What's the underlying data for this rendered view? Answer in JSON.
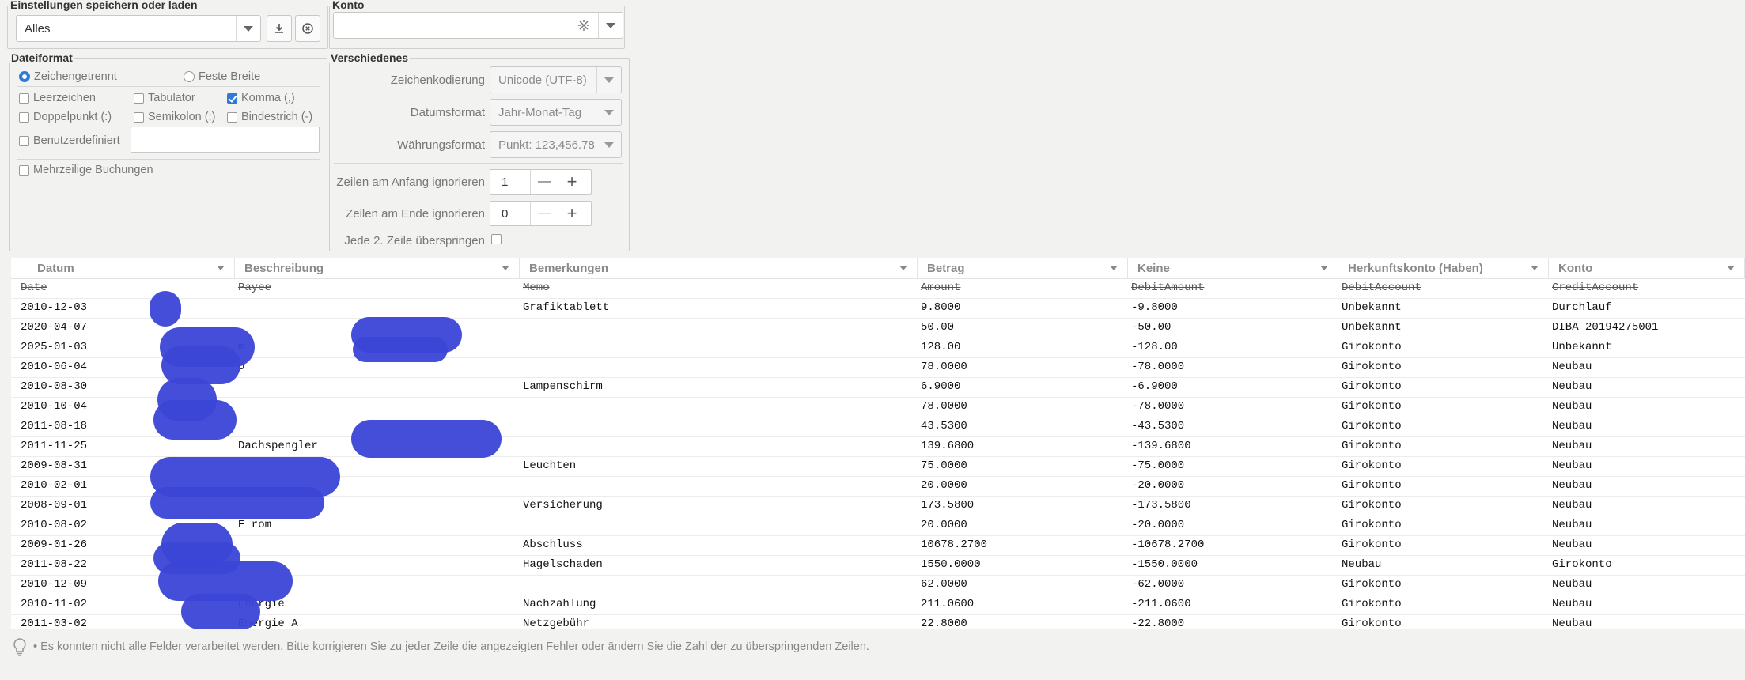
{
  "settings": {
    "legend": "Einstellungen speichern oder laden",
    "preset_value": "Alles",
    "save_icon": "download-icon",
    "clear_icon": "circle-x-icon"
  },
  "konto": {
    "legend": "Konto",
    "value": ""
  },
  "dateiformat": {
    "legend": "Dateiformat",
    "radio_delimited": "Zeichengetrennt",
    "radio_fixed": "Feste Breite",
    "space": "Leerzeichen",
    "tab": "Tabulator",
    "comma": "Komma (,)",
    "colon": "Doppelpunkt (:)",
    "semicolon": "Semikolon (;)",
    "dash": "Bindestrich (-)",
    "custom": "Benutzerdefiniert",
    "multiline": "Mehrzeilige Buchungen"
  },
  "verschiedenes": {
    "legend": "Verschiedenes",
    "encoding_label": "Zeichenkodierung",
    "encoding_value": "Unicode (UTF-8)",
    "date_label": "Datumsformat",
    "date_value": "Jahr-Monat-Tag",
    "currency_label": "Währungsformat",
    "currency_value": "Punkt: 123,456.78",
    "skip_start_label": "Zeilen am Anfang ignorieren",
    "skip_start_value": "1",
    "skip_end_label": "Zeilen am Ende ignorieren",
    "skip_end_value": "0",
    "every_second_label": "Jede 2. Zeile überspringen",
    "minus": "—",
    "plus": "+"
  },
  "table": {
    "columns": [
      "Datum",
      "Beschreibung",
      "Bemerkungen",
      "Betrag",
      "Keine",
      "Herkunftskonto (Haben)",
      "Konto"
    ],
    "header_row": [
      "Date",
      "Payee",
      "Memo",
      "Amount",
      "DebitAmount",
      "DebitAccount",
      "CreditAccount"
    ],
    "rows": [
      [
        "2010-12-03",
        "",
        "Grafiktablett",
        "9.8000",
        "-9.8000",
        "Unbekannt",
        "Durchlauf"
      ],
      [
        "2020-04-07",
        "",
        "",
        "50.00",
        "-50.00",
        "Unbekannt",
        "DIBA 20194275001"
      ],
      [
        "2025-01-03",
        "m",
        "",
        "128.00",
        "-128.00",
        "Girokonto",
        "Unbekannt"
      ],
      [
        "2010-06-04",
        "ö",
        "",
        "78.0000",
        "-78.0000",
        "Girokonto",
        "Neubau"
      ],
      [
        "2010-08-30",
        "",
        "Lampenschirm",
        "6.9000",
        "-6.9000",
        "Girokonto",
        "Neubau"
      ],
      [
        "2010-10-04",
        "",
        "",
        "78.0000",
        "-78.0000",
        "Girokonto",
        "Neubau"
      ],
      [
        "2011-08-18",
        "",
        "",
        "43.5300",
        "-43.5300",
        "Girokonto",
        "Neubau"
      ],
      [
        "2011-11-25",
        "Dachspengler",
        "",
        "139.6800",
        "-139.6800",
        "Girokonto",
        "Neubau"
      ],
      [
        "2009-08-31",
        "",
        "Leuchten",
        "75.0000",
        "-75.0000",
        "Girokonto",
        "Neubau"
      ],
      [
        "2010-02-01",
        "",
        "",
        "20.0000",
        "-20.0000",
        "Girokonto",
        "Neubau"
      ],
      [
        "2008-09-01",
        "",
        "Versicherung",
        "173.5800",
        "-173.5800",
        "Girokonto",
        "Neubau"
      ],
      [
        "2010-08-02",
        "E                 rom",
        "",
        "20.0000",
        "-20.0000",
        "Girokonto",
        "Neubau"
      ],
      [
        "2009-01-26",
        "",
        "Abschluss",
        "10678.2700",
        "-10678.2700",
        "Girokonto",
        "Neubau"
      ],
      [
        "2011-08-22",
        "",
        "Hagelschaden",
        "1550.0000",
        "-1550.0000",
        "Neubau",
        "Girokonto"
      ],
      [
        "2010-12-09",
        "",
        "",
        "62.0000",
        "-62.0000",
        "Girokonto",
        "Neubau"
      ],
      [
        "2010-11-02",
        "Energie",
        "Nachzahlung",
        "211.0600",
        "-211.0600",
        "Girokonto",
        "Neubau"
      ],
      [
        "2011-03-02",
        "Energie A",
        "Netzgebühr",
        "22.8000",
        "-22.8000",
        "Girokonto",
        "Neubau"
      ]
    ]
  },
  "status": {
    "icon": "lightbulb-icon",
    "text": "• Es konnten nicht alle Felder verarbeitet werden. Bitte korrigieren Sie zu jeder Zeile die angezeigten Fehler oder ändern Sie die Zahl der zu überspringenden Zeilen."
  },
  "colors": {
    "accent": "#2d7ad8",
    "redaction": "#3b44d6"
  }
}
